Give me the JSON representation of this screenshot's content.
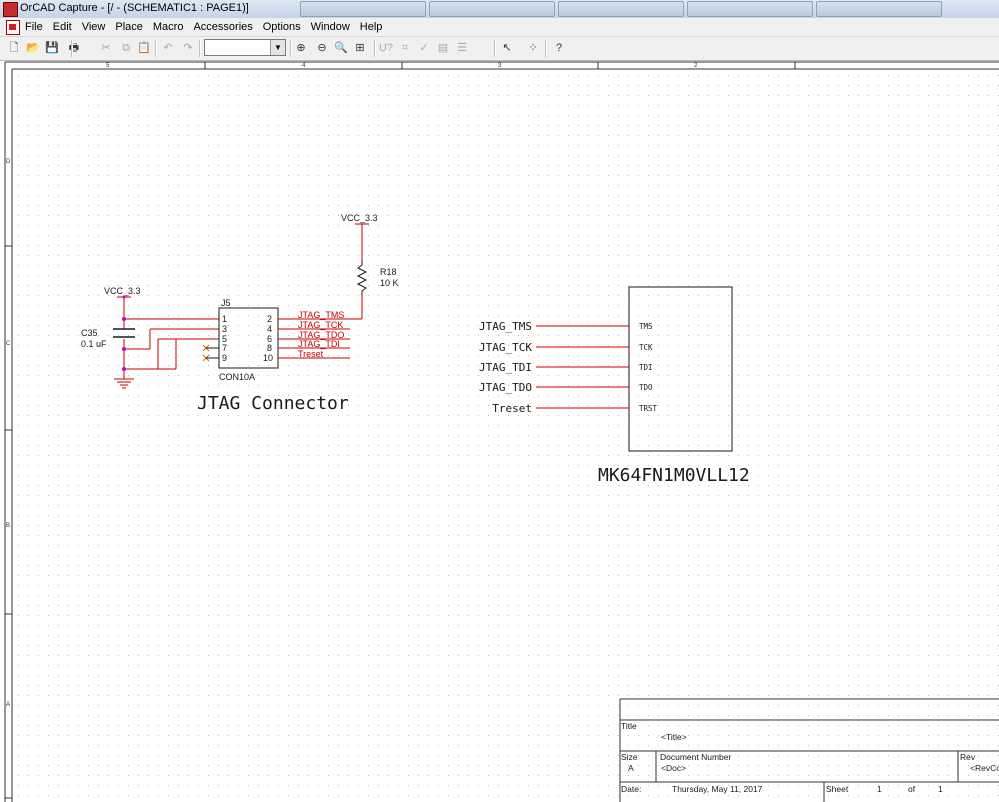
{
  "window": {
    "title": "OrCAD Capture - [/ - (SCHEMATIC1 : PAGE1)]"
  },
  "menu": [
    "File",
    "Edit",
    "View",
    "Place",
    "Macro",
    "Accessories",
    "Options",
    "Window",
    "Help"
  ],
  "toolbar": {
    "zoom_value": "",
    "buttons": [
      {
        "name": "new-icon",
        "glyph": "🗋",
        "disabled": false
      },
      {
        "name": "open-icon",
        "glyph": "📂",
        "disabled": false
      },
      {
        "name": "save-icon",
        "glyph": "💾",
        "disabled": false
      },
      {
        "name": "print-icon",
        "glyph": "🖶",
        "disabled": false
      },
      {
        "name": "cut-icon",
        "glyph": "✂",
        "disabled": true
      },
      {
        "name": "copy-icon",
        "glyph": "⧉",
        "disabled": true
      },
      {
        "name": "paste-icon",
        "glyph": "📋",
        "disabled": false
      },
      {
        "name": "undo-icon",
        "glyph": "↶",
        "disabled": true
      },
      {
        "name": "redo-icon",
        "glyph": "↷",
        "disabled": true
      },
      {
        "name": "zoom-in-icon",
        "glyph": "⊕",
        "disabled": false
      },
      {
        "name": "zoom-out-icon",
        "glyph": "⊖",
        "disabled": false
      },
      {
        "name": "zoom-area-icon",
        "glyph": "🔍",
        "disabled": false
      },
      {
        "name": "zoom-all-icon",
        "glyph": "⊞",
        "disabled": false
      },
      {
        "name": "annotate-icon",
        "glyph": "U?",
        "disabled": true
      },
      {
        "name": "drc-icon",
        "glyph": "⌗",
        "disabled": true
      },
      {
        "name": "cross-reference-icon",
        "glyph": "✓",
        "disabled": true
      },
      {
        "name": "netlist-icon",
        "glyph": "▤",
        "disabled": true
      },
      {
        "name": "bom-icon",
        "glyph": "☰",
        "disabled": true
      },
      {
        "name": "pointer-icon",
        "glyph": "↖",
        "disabled": false
      },
      {
        "name": "snap-grid-icon",
        "glyph": "⁘",
        "disabled": false
      },
      {
        "name": "help-icon",
        "glyph": "?",
        "disabled": false
      }
    ]
  },
  "border": {
    "top_zones": [
      "5",
      "4",
      "3",
      "2"
    ],
    "left_zones": [
      "D",
      "C",
      "B",
      "A"
    ]
  },
  "schematic": {
    "power_vcc": "VCC_3.3",
    "power_vcc_2": "VCC_3.3",
    "resistor": {
      "ref": "R18",
      "value": "10 K"
    },
    "capacitor": {
      "ref": "C35",
      "value": "0.1 uF"
    },
    "connector": {
      "ref": "J5",
      "part": "CON10A",
      "left_pins": [
        "1",
        "3",
        "5",
        "7",
        "9"
      ],
      "right_pins": [
        "2",
        "4",
        "6",
        "8",
        "10"
      ],
      "nets": [
        "JTAG_TMS",
        "JTAG_TCK",
        "JTAG_TDO",
        "JTAG_TDI",
        "Treset"
      ]
    },
    "connector_caption": "JTAG Connector",
    "mcu": {
      "part": "MK64FN1M0VLL12",
      "pins": [
        "TMS",
        "TCK",
        "TDI",
        "TDO",
        "TRST"
      ],
      "nets": [
        "JTAG_TMS",
        "JTAG_TCK",
        "JTAG_TDI",
        "JTAG_TDO",
        "Treset"
      ]
    }
  },
  "title_block": {
    "title_label": "Title",
    "title_value": "<Title>",
    "size_label": "Size",
    "size_value": "A",
    "docnum_label": "Document Number",
    "docnum_value": "<Doc>",
    "rev_label": "Rev",
    "rev_value": "<RevCode>",
    "date_label": "Date:",
    "date_value": "Thursday, May 11, 2017",
    "sheet_label": "Sheet",
    "sheet_value": "1",
    "of_label": "of",
    "of_value": "1"
  },
  "colors": {
    "wire": "#cc0000",
    "part": "#1a1a1a",
    "junction": "#cc00cc",
    "grid": "#bdbdbd",
    "nc_marker": "#cc6600"
  }
}
